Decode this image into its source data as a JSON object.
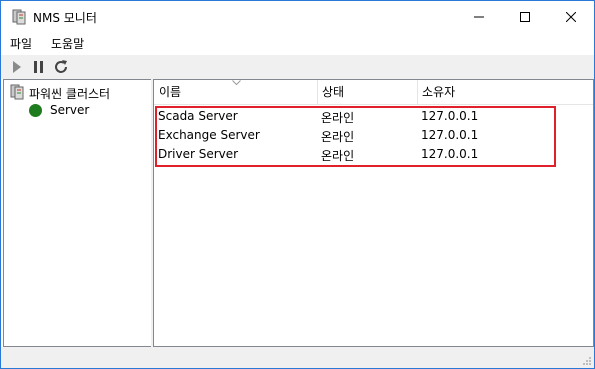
{
  "window": {
    "title": "NMS 모니터",
    "controls": [
      "minimize",
      "maximize",
      "close"
    ]
  },
  "menu": {
    "items": [
      {
        "label": "파일"
      },
      {
        "label": "도움말"
      }
    ]
  },
  "toolbar": {
    "buttons": [
      "play-icon",
      "pause-icon",
      "refresh-icon"
    ]
  },
  "tree": {
    "root_label": "파워씬 클러스터",
    "children": [
      {
        "label": "Server",
        "status_color": "#1e7b1e"
      }
    ]
  },
  "list": {
    "columns": [
      "이름",
      "상태",
      "소유자"
    ],
    "rows": [
      {
        "name": "Scada Server",
        "state": "온라인",
        "owner": "127.0.0.1"
      },
      {
        "name": "Exchange Server",
        "state": "온라인",
        "owner": "127.0.0.1"
      },
      {
        "name": "Driver Server",
        "state": "온라인",
        "owner": "127.0.0.1"
      }
    ]
  },
  "colors": {
    "window_border": "#2b79d6",
    "highlight_border": "#e0202a",
    "status_online": "#1e7b1e"
  }
}
